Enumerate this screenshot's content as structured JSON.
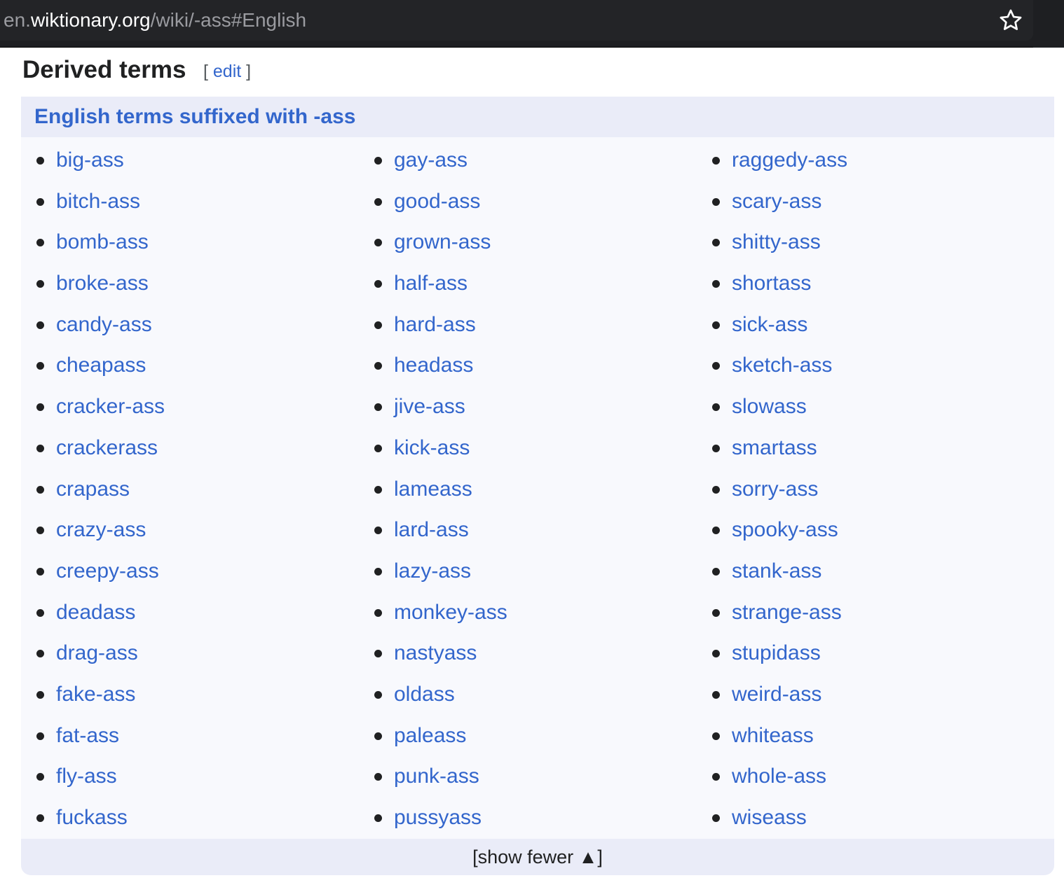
{
  "browser": {
    "url_subdomain": "en.",
    "url_host": "wiktionary.org",
    "url_path": "/wiki/-ass#English",
    "bookmark_icon": "star-outline-icon"
  },
  "section": {
    "title": "Derived terms",
    "edit_open": "[ ",
    "edit_label": "edit",
    "edit_close": " ]"
  },
  "box": {
    "title": "English terms suffixed with -ass",
    "footer_label": "[show fewer ▲]",
    "columns": [
      [
        "big-ass",
        "bitch-ass",
        "bomb-ass",
        "broke-ass",
        "candy-ass",
        "cheapass",
        "cracker-ass",
        "crackerass",
        "crapass",
        "crazy-ass",
        "creepy-ass",
        "deadass",
        "drag-ass",
        "fake-ass",
        "fat-ass",
        "fly-ass",
        "fuckass"
      ],
      [
        "gay-ass",
        "good-ass",
        "grown-ass",
        "half-ass",
        "hard-ass",
        "headass",
        "jive-ass",
        "kick-ass",
        "lameass",
        "lard-ass",
        "lazy-ass",
        "monkey-ass",
        "nastyass",
        "oldass",
        "paleass",
        "punk-ass",
        "pussyass"
      ],
      [
        "raggedy-ass",
        "scary-ass",
        "shitty-ass",
        "shortass",
        "sick-ass",
        "sketch-ass",
        "slowass",
        "smartass",
        "sorry-ass",
        "spooky-ass",
        "stank-ass",
        "strange-ass",
        "stupidass",
        "weird-ass",
        "whiteass",
        "whole-ass",
        "wiseass"
      ]
    ]
  },
  "colors": {
    "link": "#3366cc",
    "text": "#202122",
    "box_bg": "#f8f9fd",
    "box_header_bg": "#eaecf8",
    "browser_bg": "#1e1f22"
  }
}
